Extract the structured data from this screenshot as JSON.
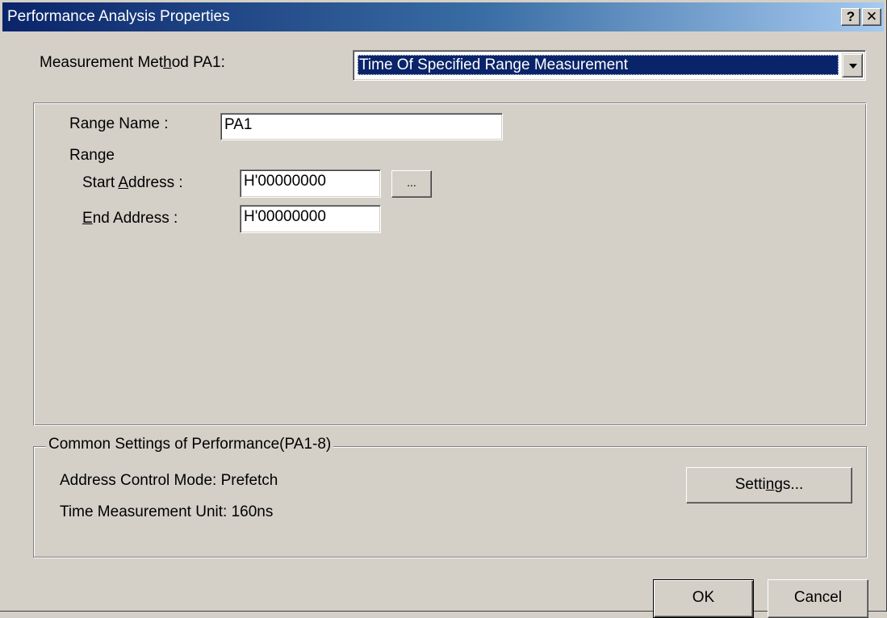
{
  "window": {
    "title": "Performance Analysis Properties",
    "help_button": "?",
    "close_button": "✕"
  },
  "measurement": {
    "label_pre": "Measurement Met",
    "label_accel": "h",
    "label_post": "od PA1:",
    "selected": "Time Of Specified Range Measurement",
    "dropdown_icon": "chevron-down-icon"
  },
  "range": {
    "name_label_pre": "Ran",
    "name_label_accel": "g",
    "name_label_post": "e Name :",
    "name_value": "PA1",
    "section_label": "Range",
    "start_label_pre": "Start ",
    "start_label_accel": "A",
    "start_label_post": "ddress :",
    "start_value": "H'00000000",
    "browse_label": "...",
    "end_label_accel": "E",
    "end_label_post": "nd Address :",
    "end_value": "H'00000000"
  },
  "common": {
    "group_title": "Common Settings of Performance(PA1-8)",
    "address_mode": "Address Control Mode: Prefetch",
    "time_unit": "Time Measurement Unit: 160ns",
    "settings_pre": "Setti",
    "settings_accel": "n",
    "settings_post": "gs..."
  },
  "footer": {
    "ok_label": "OK",
    "cancel_label": "Cancel"
  }
}
